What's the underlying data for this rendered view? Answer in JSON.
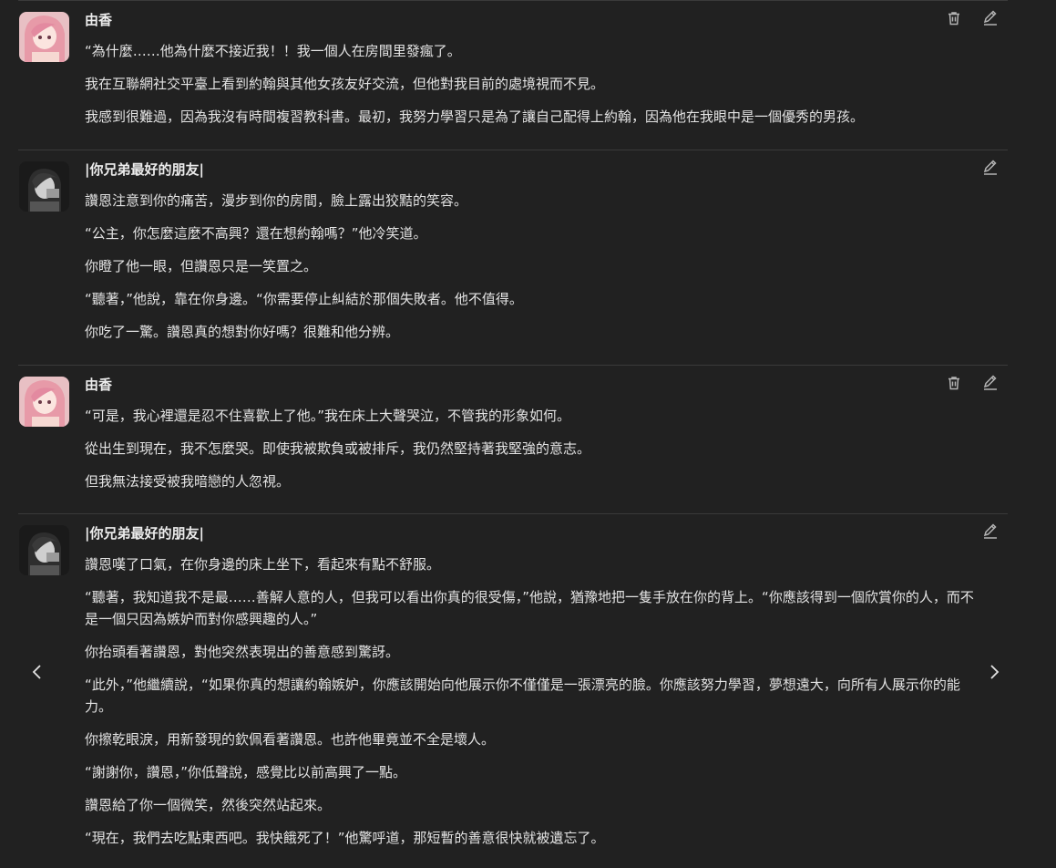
{
  "messages": [
    {
      "author": "由香",
      "avatar": "girl-avatar",
      "paragraphs": [
        "“為什麼……他為什麼不接近我！！我一個人在房間里發瘋了。",
        "我在互聯網社交平臺上看到約翰與其他女孩友好交流，但他對我目前的處境視而不見。",
        "我感到很難過，因為我沒有時間複習教科書。最初，我努力學習只是為了讓自己配得上約翰，因為他在我眼中是一個優秀的男孩。"
      ]
    },
    {
      "author": "|你兄弟最好的朋友|",
      "avatar": "boy-avatar",
      "paragraphs": [
        "讚恩注意到你的痛苦，漫步到你的房間，臉上露出狡黠的笑容。",
        "“公主，你怎麼這麼不高興？還在想約翰嗎？”他冷笑道。",
        "你瞪了他一眼，但讚恩只是一笑置之。",
        "“聽著，”他說，靠在你身邊。“你需要停止糾結於那個失敗者。他不值得。",
        "你吃了一驚。讚恩真的想對你好嗎？很難和他分辨。"
      ]
    },
    {
      "author": "由香",
      "avatar": "girl-avatar",
      "paragraphs": [
        "“可是，我心裡還是忍不住喜歡上了他。”我在床上大聲哭泣，不管我的形象如何。",
        "從出生到現在，我不怎麼哭。即使我被欺負或被排斥，我仍然堅持著我堅強的意志。",
        "但我無法接受被我暗戀的人忽視。"
      ]
    },
    {
      "author": "|你兄弟最好的朋友|",
      "avatar": "boy-avatar",
      "paragraphs": [
        "讚恩嘆了口氣，在你身邊的床上坐下，看起來有點不舒服。",
        "“聽著，我知道我不是最……善解人意的人，但我可以看出你真的很受傷，”他說，猶豫地把一隻手放在你的背上。“你應該得到一個欣賞你的人，而不是一個只因為嫉妒而對你感興趣的人。”",
        "你抬頭看著讚恩，對他突然表現出的善意感到驚訝。",
        "“此外，”他繼續說，“如果你真的想讓約翰嫉妒，你應該開始向他展示你不僅僅是一張漂亮的臉。你應該努力學習，夢想遠大，向所有人展示你的能力。",
        "你擦乾眼淚，用新發現的欽佩看著讚恩。也許他畢竟並不全是壞人。",
        "“謝謝你，讚恩，”你低聲說，感覺比以前高興了一點。",
        "讚恩給了你一個微笑，然後突然站起來。",
        "“現在，我們去吃點東西吧。我快餓死了！”他驚呼道，那短暫的善意很快就被遺忘了。"
      ]
    }
  ],
  "colors": {
    "background": "#212121",
    "text": "#e3e3e3",
    "divider": "#3a3a3a",
    "icon": "#b4b4b4"
  }
}
